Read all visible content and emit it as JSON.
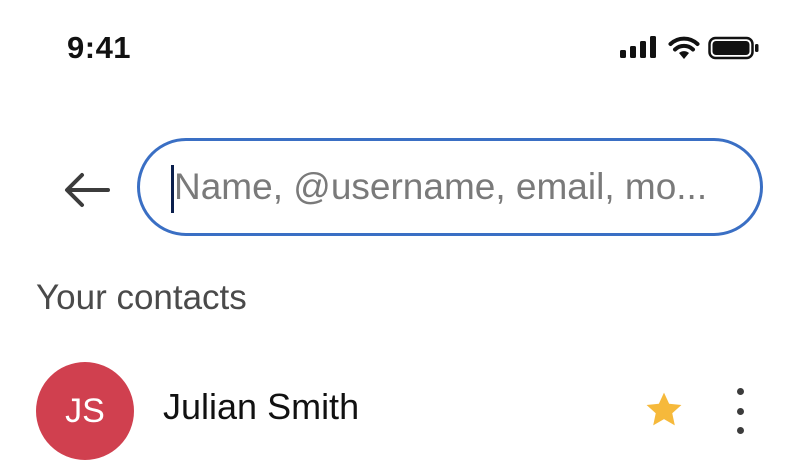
{
  "status_bar": {
    "time": "9:41",
    "icons": [
      "cellular-signal-icon",
      "wifi-icon",
      "battery-icon"
    ]
  },
  "search": {
    "placeholder": "Name, @username, email, mo...",
    "value": "",
    "back_icon": "back-arrow-icon",
    "accent_color": "#3a6fc4"
  },
  "contacts_section": {
    "title": "Your contacts",
    "contacts": [
      {
        "initials": "JS",
        "name": "Julian Smith",
        "avatar_color": "#d0404f",
        "starred": true,
        "star_color": "#f6b93b"
      }
    ]
  }
}
